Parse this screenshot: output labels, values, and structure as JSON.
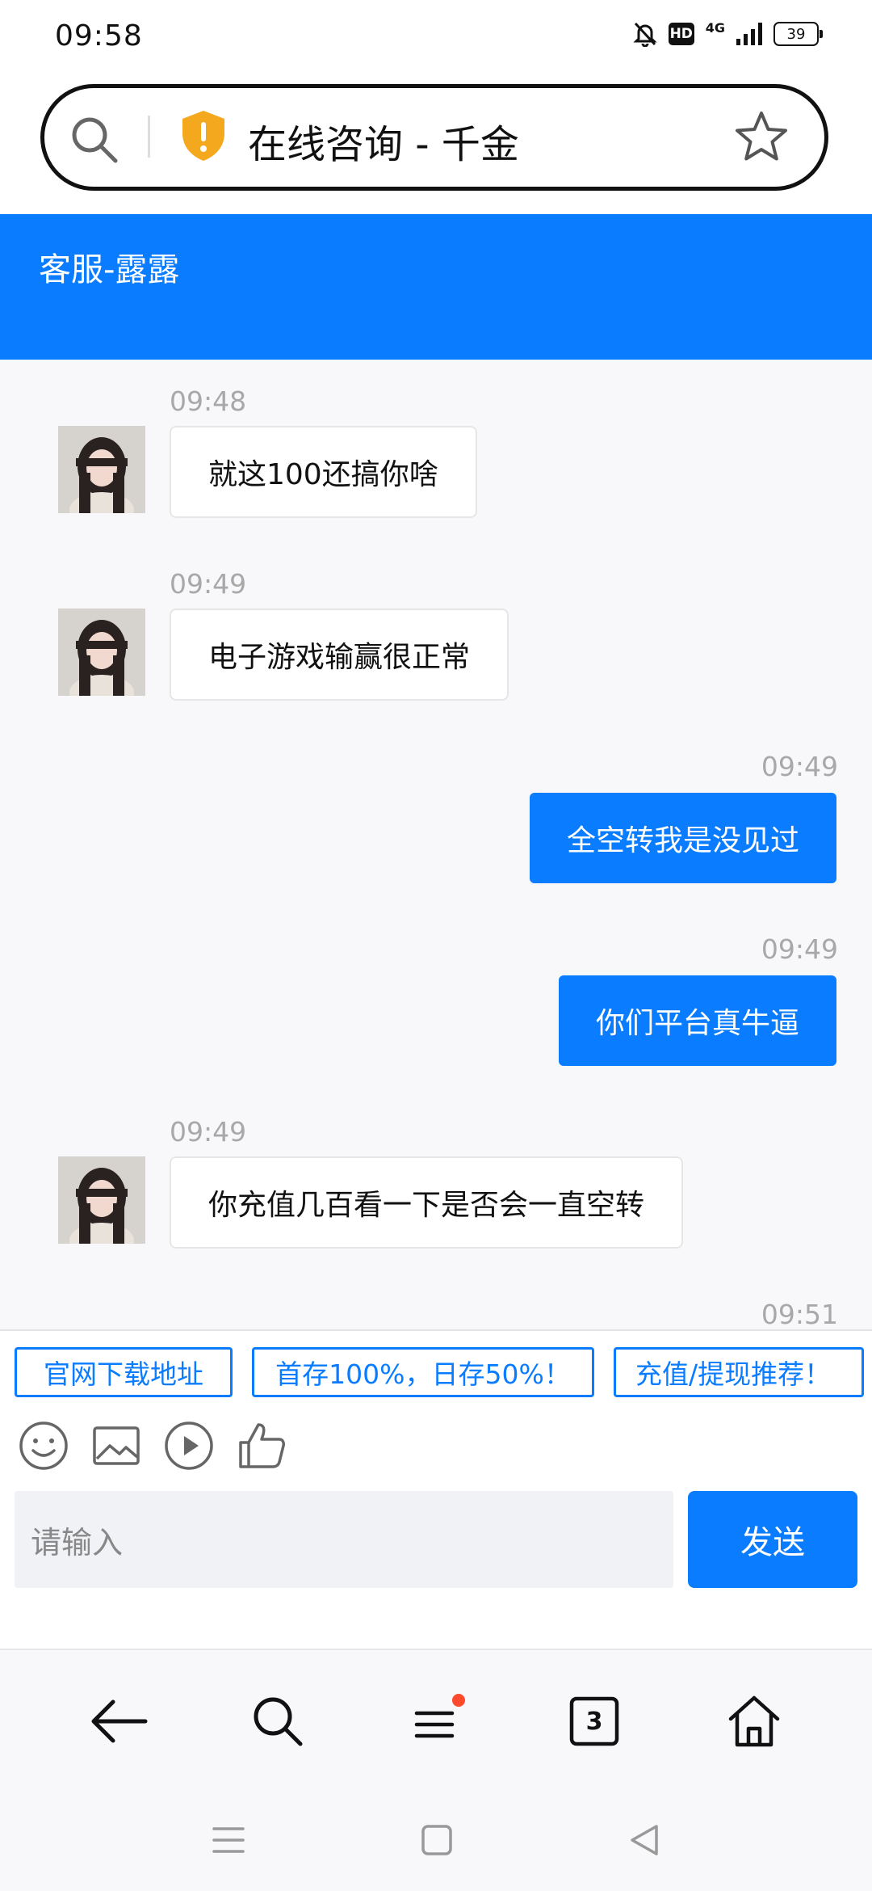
{
  "status_bar": {
    "time": "09:58",
    "network": "4G",
    "hd": "HD",
    "battery": "39"
  },
  "browser": {
    "page_title": "在线咨询 - 千金",
    "tab_count": "3"
  },
  "chat": {
    "agent_name": "客服-露露",
    "messages": [
      {
        "from": "agent",
        "time": "09:48",
        "text": "就这100还搞你啥"
      },
      {
        "from": "agent",
        "time": "09:49",
        "text": "电子游戏输赢很正常"
      },
      {
        "from": "user",
        "time": "09:49",
        "text": "全空转我是没见过"
      },
      {
        "from": "user",
        "time": "09:49",
        "text": "你们平台真牛逼"
      },
      {
        "from": "agent",
        "time": "09:49",
        "text": "你充值几百看一下是否会一直空转"
      },
      {
        "from": "user",
        "time": "09:51",
        "text": ""
      }
    ]
  },
  "quick_links": [
    "官网下载地址",
    "首存100%，日存50%！",
    "充值/提现推荐！"
  ],
  "toolbar_icons": [
    "emoji-icon",
    "image-icon",
    "video-icon",
    "thumbs-up-icon"
  ],
  "composer": {
    "placeholder": "请输入",
    "send_label": "发送"
  },
  "colors": {
    "accent": "#0a7cff",
    "badge": "#ff4a2d",
    "shield": "#f4a81d"
  }
}
